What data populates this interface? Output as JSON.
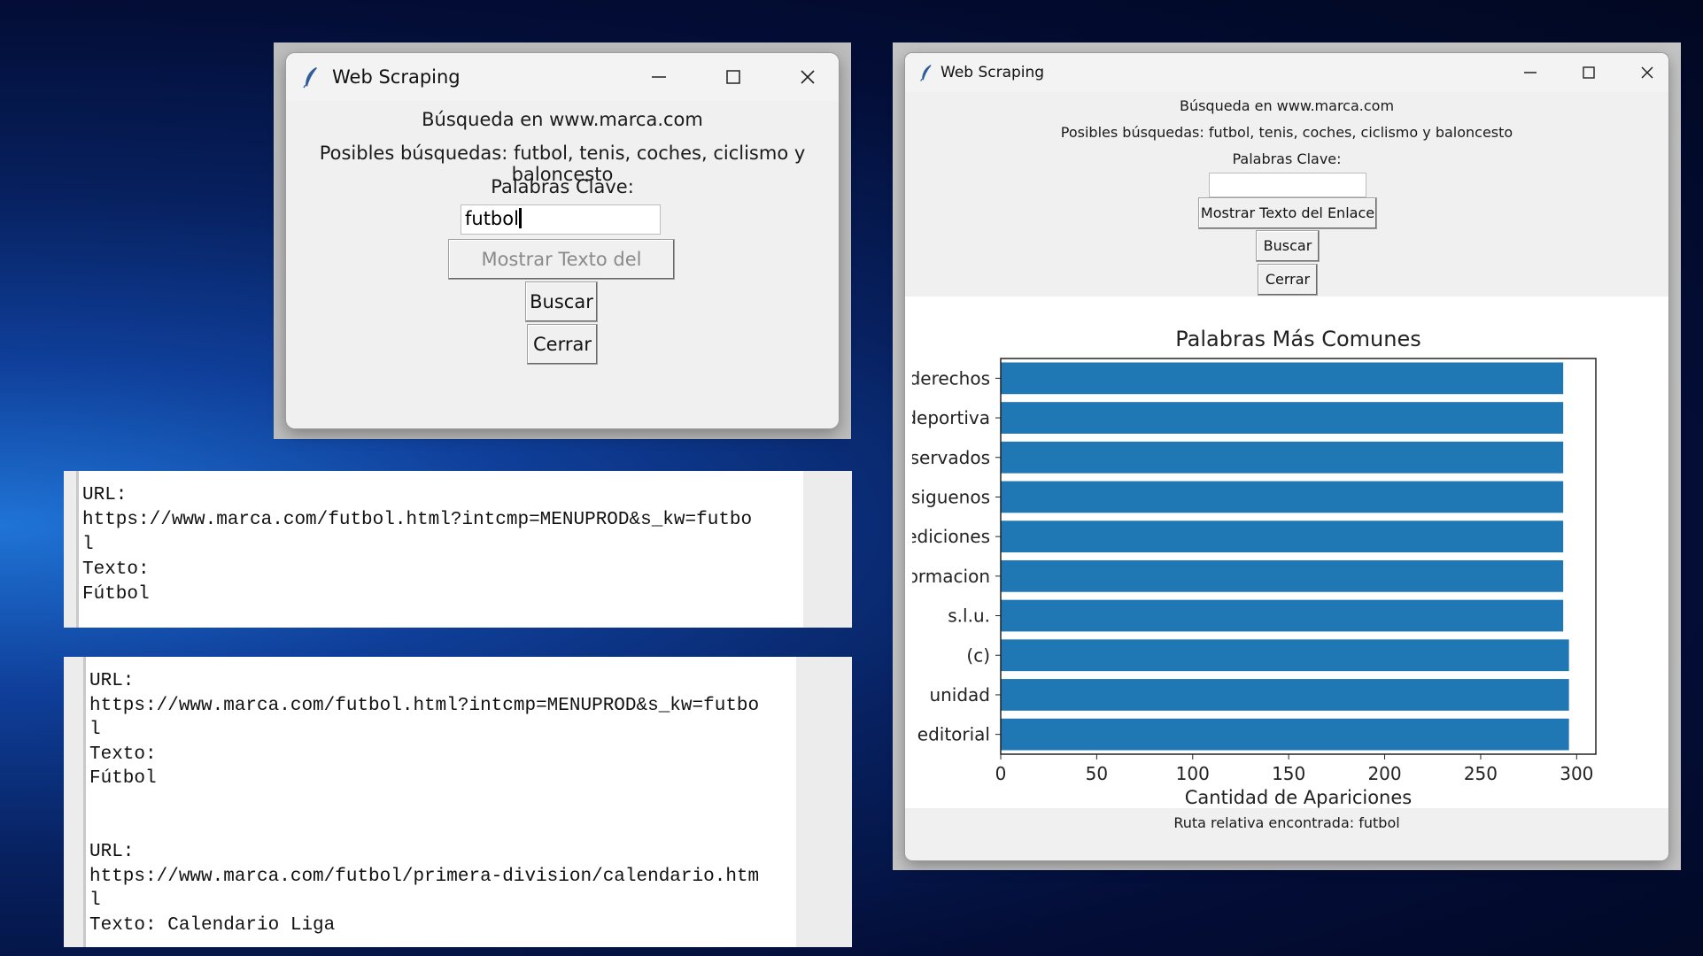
{
  "windows": {
    "left": {
      "title": "Web Scraping",
      "heading": "Búsqueda en www.marca.com",
      "subheading": "Posibles búsquedas: futbol, tenis, coches, ciclismo y baloncesto",
      "keywords_label": "Palabras Clave:",
      "keywords_value": "futbol",
      "show_text_button": "Mostrar Texto del Enlace",
      "search_button": "Buscar",
      "close_button": "Cerrar"
    },
    "right": {
      "title": "Web Scraping",
      "heading": "Búsqueda en www.marca.com",
      "subheading": "Posibles búsquedas: futbol, tenis, coches, ciclismo y baloncesto",
      "keywords_label": "Palabras Clave:",
      "keywords_value": "",
      "show_text_button": "Mostrar Texto del Enlace",
      "search_button": "Buscar",
      "close_button": "Cerrar",
      "status": "Ruta relativa encontrada: futbol"
    }
  },
  "output_panels": {
    "first": [
      "URL:",
      "https://www.marca.com/futbol.html?intcmp=MENUPROD&s_kw=futbo",
      "l",
      "Texto:",
      "Fútbol"
    ],
    "second": [
      "URL:",
      "https://www.marca.com/futbol.html?intcmp=MENUPROD&s_kw=futbo",
      "l",
      "Texto:",
      "Fútbol",
      "",
      "",
      "URL:",
      "https://www.marca.com/futbol/primera-division/calendario.htm",
      "l",
      "Texto: Calendario Liga"
    ]
  },
  "icons": {
    "app": "feather-icon",
    "minimize": "minimize-icon",
    "maximize": "maximize-icon",
    "close": "close-icon"
  },
  "chart_data": {
    "type": "bar",
    "orientation": "horizontal",
    "title": "Palabras Más Comunes",
    "xlabel": "Cantidad de Apariciones",
    "ylabel": "",
    "categories": [
      "derechos",
      "deportiva",
      "reservados",
      "siguenos",
      "ediciones",
      "informacion",
      "s.l.u.",
      "(c)",
      "unidad",
      "editorial"
    ],
    "category_labels_visible": [
      "derechos",
      "deportiva",
      "eservados",
      "siguenos",
      "ediciones",
      "ormacion",
      "s.l.u.",
      "(c)",
      "unidad",
      "editorial"
    ],
    "values": [
      293,
      293,
      293,
      293,
      293,
      293,
      293,
      296,
      296,
      296
    ],
    "xlim": [
      0,
      310
    ],
    "xticks": [
      0,
      50,
      100,
      150,
      200,
      250,
      300
    ],
    "grid": false,
    "bar_color": "#1f77b4"
  }
}
